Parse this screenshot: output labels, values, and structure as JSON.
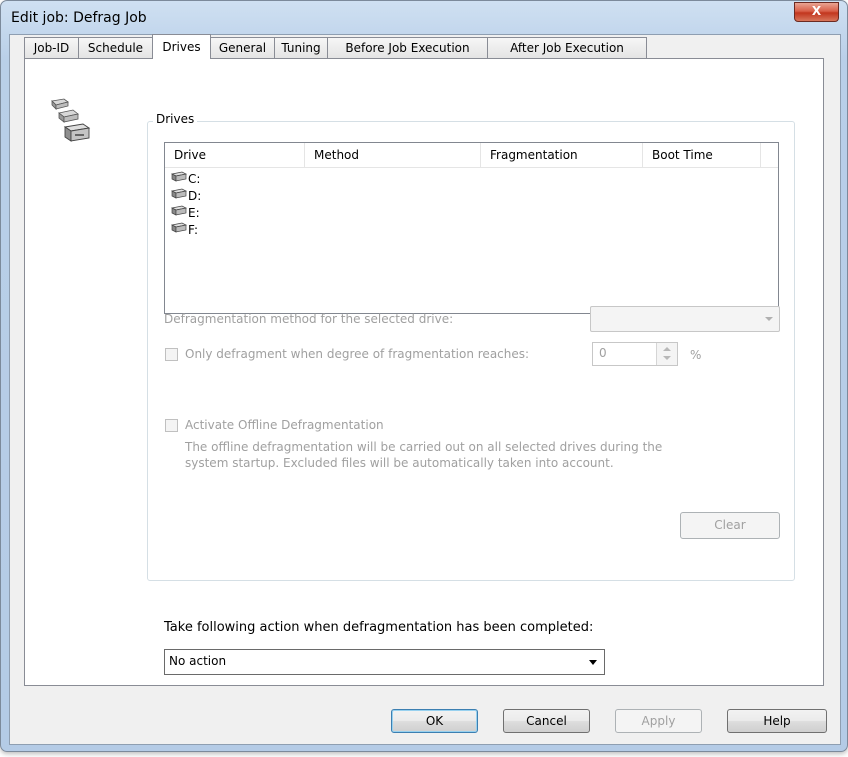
{
  "window": {
    "title": "Edit job: Defrag Job",
    "close_glyph": "X"
  },
  "tabs": [
    {
      "label": "Job-ID"
    },
    {
      "label": "Schedule"
    },
    {
      "label": "Drives",
      "active": true
    },
    {
      "label": "General"
    },
    {
      "label": "Tuning"
    },
    {
      "label": "Before Job Execution"
    },
    {
      "label": "After Job Execution"
    }
  ],
  "drives_group": {
    "label": "Drives",
    "columns": [
      "Drive",
      "Method",
      "Fragmentation",
      "Boot Time"
    ],
    "rows": [
      {
        "drive": "C:",
        "icon": "hard-drive-icon"
      },
      {
        "drive": "D:",
        "icon": "hard-drive-icon"
      },
      {
        "drive": "E:",
        "icon": "hard-drive-icon"
      },
      {
        "drive": "F:",
        "icon": "hard-drive-icon"
      }
    ],
    "method_label": "Defragmentation method for the selected drive:",
    "method_value": "",
    "only_defrag_label": "Only defragment when degree of fragmentation reaches:",
    "only_defrag_value": "0",
    "percent": "%",
    "offline_label": "Activate Offline Defragmentation",
    "offline_desc_1": "The offline defragmentation will be carried out on all selected drives during the",
    "offline_desc_2": "system startup. Excluded files will be automatically taken into account.",
    "clear_label": "Clear"
  },
  "completion": {
    "label": "Take following action when defragmentation has been completed:",
    "value": "No action"
  },
  "buttons": {
    "ok": "OK",
    "cancel": "Cancel",
    "apply": "Apply",
    "help": "Help"
  },
  "colors": {
    "titlebar": "#b9cfe8",
    "close": "#c2361e",
    "disabled_text": "#a0a0a0"
  }
}
